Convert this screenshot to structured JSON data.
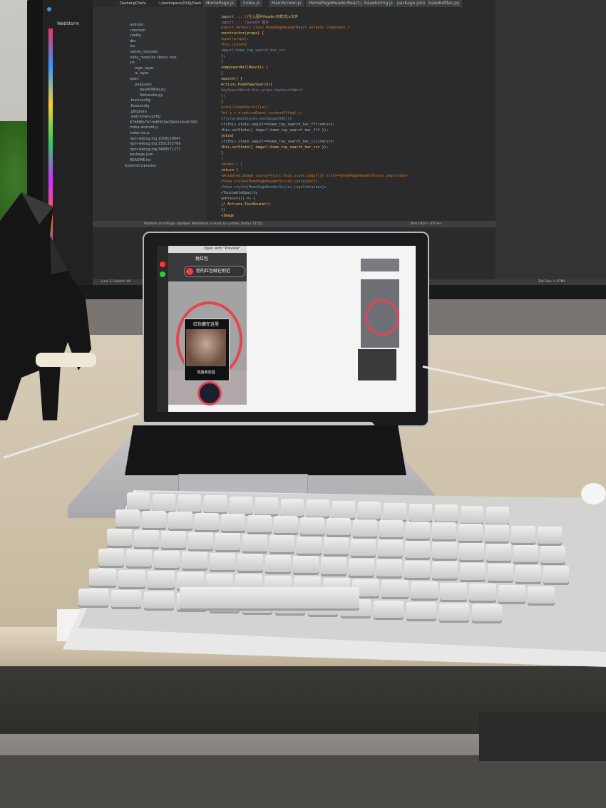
{
  "monitor": {
    "dock_label": "WebStorm",
    "project_header": "DashengChefu",
    "path_text": "~/workspace/DSKJ/Dash",
    "tabs": [
      "HomePage.js",
      "index.js",
      "MainScreen.js",
      "HomePageHeaderReact.js",
      "base64img.js",
      "package.json",
      "base64files.py"
    ],
    "tree": [
      "android",
      "common",
      "config",
      "doc",
      "ios",
      "native_modules",
      "node_modules  library root",
      "src",
      "logic_layer",
      "ui_layer",
      "tools",
      "pngquant",
      "base64files.py",
      "filehandle.py",
      ".buckconfig",
      ".flowconfig",
      ".gitignore",
      ".watchmanconfig",
      "67b8f6b7b7cb8f303e29b1b16c00390",
      "index.android.js",
      "index.ios.js",
      "npm-debug.log.1029120847",
      "npm-debug.log.3351353769",
      "npm-debug.log.3480571277",
      "package.json",
      "README.txt",
      "External Libraries"
    ],
    "code": [
      "import ...          //引入图片Header的样式js文件",
      "import ...'/base64 图片",
      "export default class HomePageHeaderReact extends Component {",
      "  constructor(props) {",
      "    super(props);",
      "    this.state={",
      "      imgurl:home_top_search_bar_ccc",
      "    };",
      "  }",
      "  componentWillMount() {",
      "  }",
      "  search() {",
      "    Actions.HomePageSearch({",
      "      keySearchWord:this.props.keySearchWord",
      "    })",
      "  }",
      "  scrollViewOnScroll(e){",
      "    let y = e.nativeEvent.contentOffset.y;",
      "    if(y<globalStyles.exchange(600)){",
      "      if(this.state.imgurl==home_top_search_bar_fff)return;",
      "      this.setState({ imgurl:home_top_search_bar_fff });",
      "    }else{",
      "      if(this.state.imgurl==home_top_search_bar_ccc)return;",
      "      this.setState({ imgurl:home_top_search_bar_ccc });",
      "    }",
      "  }",
      "  render() {",
      "    return (",
      "      <Animated.Image source={{uri:this.state.imgurl}} style={HomePageHeaderStyles.imgstyle}>",
      "        <View style={HomePageHeaderStyles.container}>",
      "          <View style={HomePageHeaderStyles.logoContainer}>",
      "            <TouchableOpacity",
      "              onPress={() => {",
      "                // Actions.TestRouter()",
      "              }}",
      "              <Image"
    ],
    "status_left": "Platform and Plugin Updates: WebStorm is ready to update. (today 13:55)",
    "status_right": "39:6   CRLF÷   UTF-8÷",
    "bottom_left": "Line 1, Column 44",
    "bottom_right": "Tab Size: 4          HTML"
  },
  "laptop": {
    "preview_window_title": "Open with \"Preview\"",
    "phone_header": "抢红包",
    "pill_text": "您的红包就在附近",
    "card_title": "红包藏在这里",
    "card_caption": "凯旋商务园"
  },
  "colors": {
    "accent_red": "#e4454f",
    "ide_background": "#2b2b2b",
    "keycap": "#e6e6e4"
  }
}
